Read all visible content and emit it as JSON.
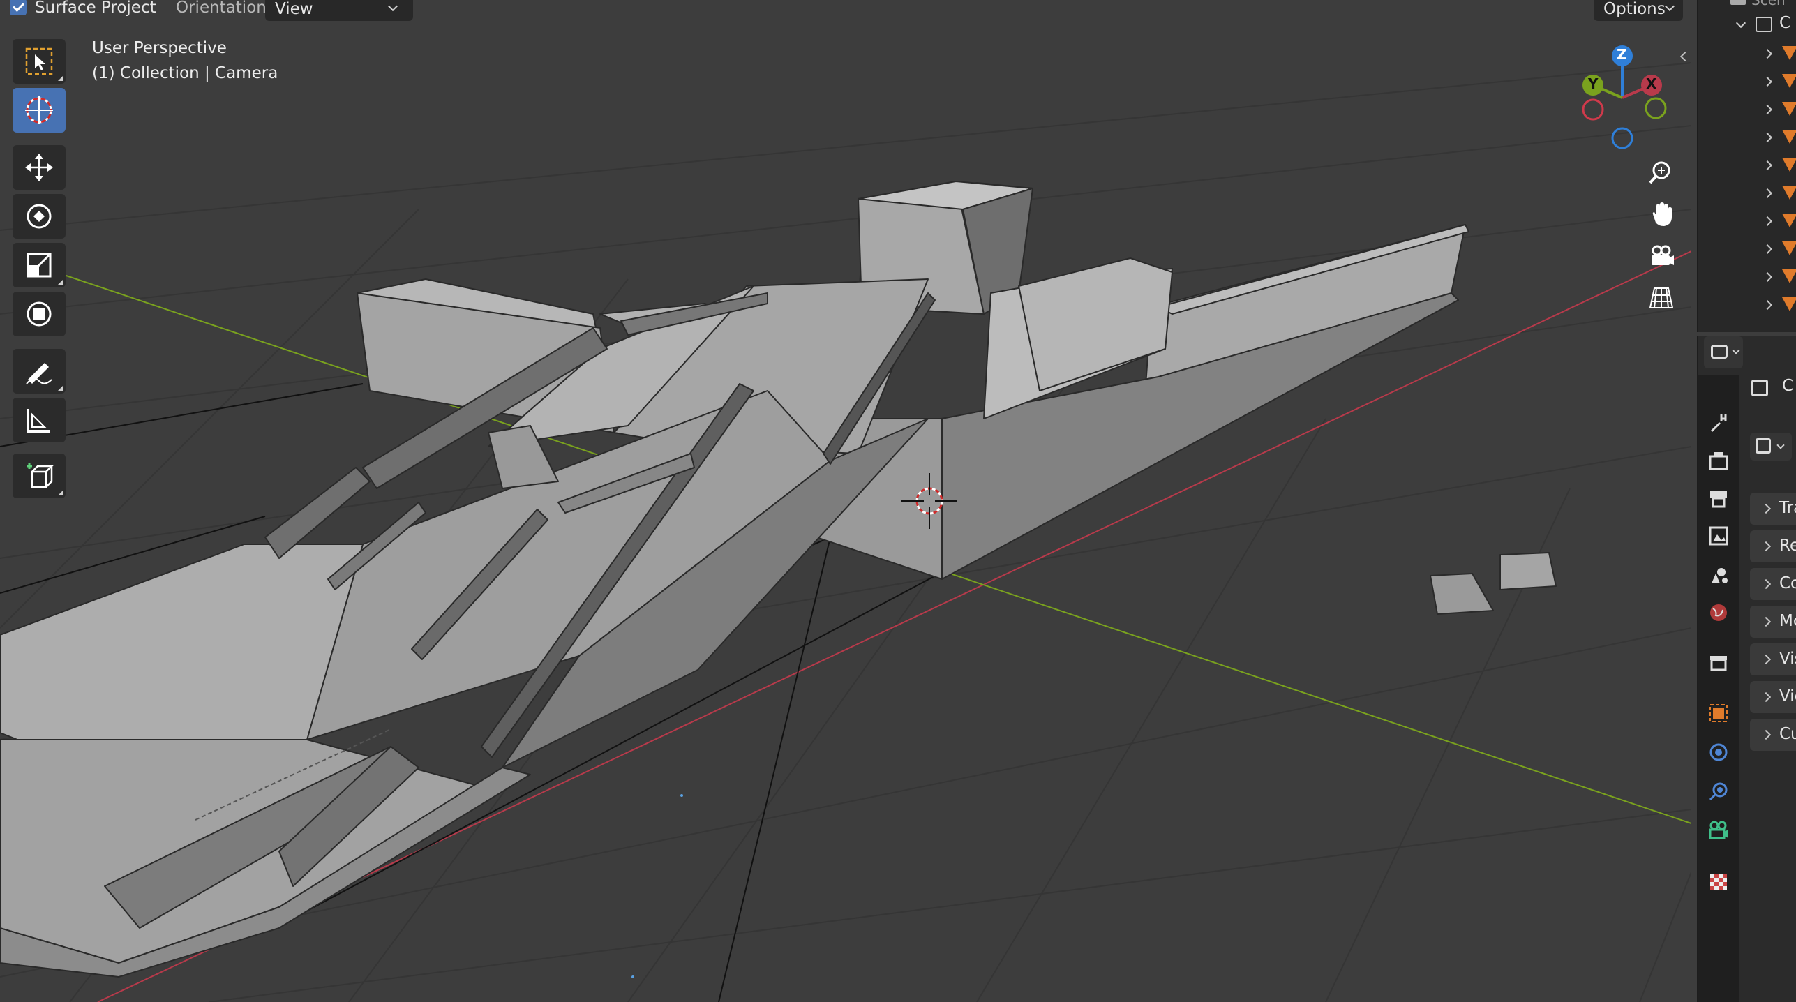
{
  "header": {
    "surface_project_label": "Surface Project",
    "surface_project_checked": true,
    "orientation_label": "Orientation:",
    "orientation_value": "View",
    "options_label": "Options"
  },
  "viewport": {
    "view_name": "User Perspective",
    "collection_info": "(1) Collection | Camera"
  },
  "toolbar": {
    "tools": [
      "select-box",
      "cursor",
      "move",
      "rotate",
      "scale",
      "transform",
      "annotate",
      "measure",
      "add-cube"
    ],
    "active_tool": "cursor"
  },
  "gizmo": {
    "z_label": "Z",
    "y_label": "Y",
    "x_label": "X"
  },
  "navigation": [
    "zoom",
    "pan",
    "camera-view",
    "perspective-toggle"
  ],
  "outliner": {
    "top_label": "Scen",
    "collection_label": "C"
  },
  "properties": {
    "header_text": "C",
    "sections": [
      "Tra",
      "Re",
      "Co",
      "Mc",
      "Vis",
      "Vie",
      "Cu"
    ]
  },
  "colors": {
    "viewport_bg": "#3d3d3d",
    "active_tool": "#4772b3",
    "x_axis": "#b83a4b",
    "y_axis": "#7aa21e",
    "z_axis": "#2f7fd8",
    "object_orange": "#e07b2b"
  }
}
